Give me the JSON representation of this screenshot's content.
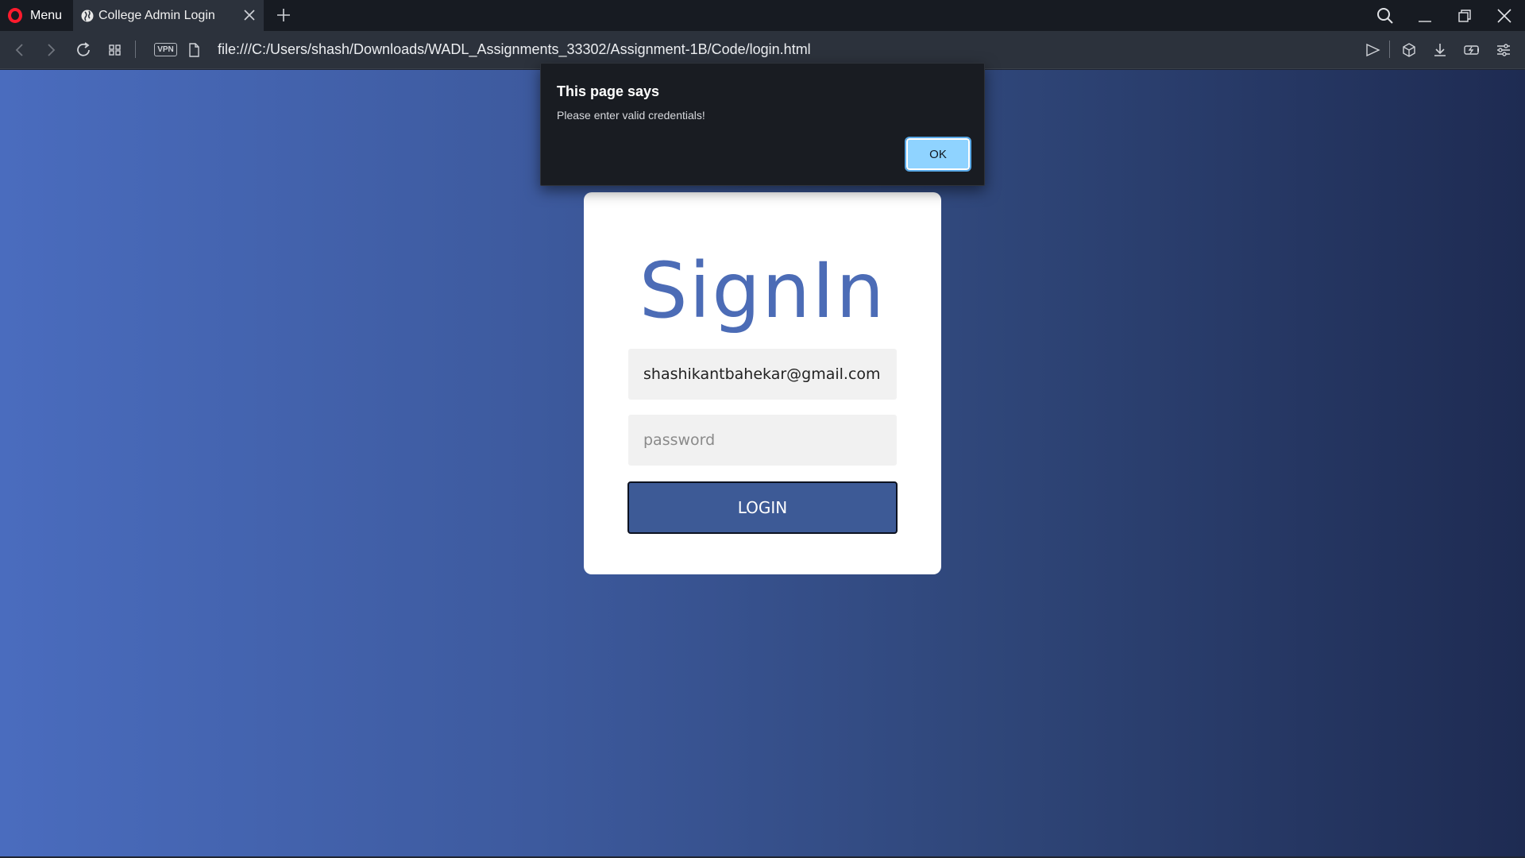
{
  "browser": {
    "menu_label": "Menu",
    "tab_title": "College Admin Login",
    "url": "file:///C:/Users/shash/Downloads/WADL_Assignments_33302/Assignment-1B/Code/login.html",
    "vpn_label": "VPN"
  },
  "dialog": {
    "title": "This page says",
    "message": "Please enter valid credentials!",
    "ok_label": "OK"
  },
  "login": {
    "heading": "SignIn",
    "email_value": "shashikantbahekar@gmail.com",
    "password_placeholder": "password",
    "button_label": "LOGIN"
  },
  "colors": {
    "heading": "#4c6cb6",
    "button": "#3d5a96",
    "ok_button": "#8fd3ff",
    "gradient_start": "#4a6cbe",
    "gradient_end": "#1e2b52"
  }
}
